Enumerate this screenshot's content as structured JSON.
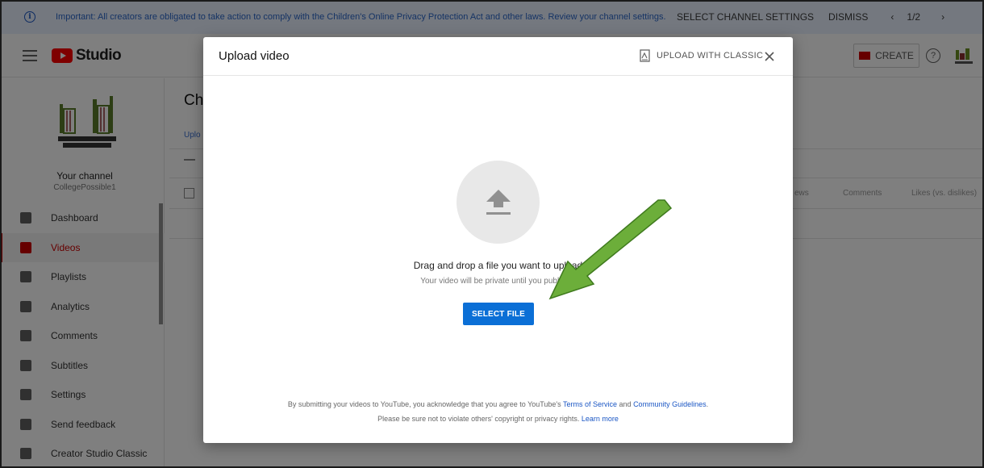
{
  "banner": {
    "message": "Important: All creators are obligated to take action to comply with the Children's Online Privacy Protection Act and other laws. Review your channel settings.",
    "select_settings": "SELECT CHANNEL SETTINGS",
    "dismiss": "DISMISS",
    "prev": "‹",
    "pager": "1/2",
    "next": "›"
  },
  "header": {
    "logo_text": "Studio",
    "create_label": "CREATE",
    "help_glyph": "?"
  },
  "sidebar": {
    "channel_name": "Your channel",
    "channel_handle": "CollegePossible1",
    "items": [
      {
        "label": "Dashboard",
        "icon": "dashboard-icon"
      },
      {
        "label": "Videos",
        "icon": "videos-icon",
        "active": true
      },
      {
        "label": "Playlists",
        "icon": "playlists-icon"
      },
      {
        "label": "Analytics",
        "icon": "analytics-icon"
      },
      {
        "label": "Comments",
        "icon": "comments-icon"
      },
      {
        "label": "Subtitles",
        "icon": "subtitles-icon"
      },
      {
        "label": "Settings",
        "icon": "settings-icon"
      },
      {
        "label": "Send feedback",
        "icon": "feedback-icon"
      },
      {
        "label": "Creator Studio Classic",
        "icon": "classic-icon"
      }
    ]
  },
  "content": {
    "title": "Cha",
    "tab": "Uplo",
    "columns": [
      "ews",
      "Comments",
      "Likes (vs. dislikes)"
    ]
  },
  "dialog": {
    "title": "Upload video",
    "classic_label": "UPLOAD WITH CLASSIC",
    "drag_text": "Drag and drop a file you want to upload",
    "private_text": "Your video will be private until you publish it",
    "select_label": "SELECT FILE",
    "terms_prefix": "By submitting your videos to YouTube, you acknowledge that you agree to YouTube's ",
    "terms_link": "Terms of Service",
    "terms_and": " and ",
    "guidelines_link": "Community Guidelines",
    "terms_suffix": ".",
    "copyright_text": "Please be sure not to violate others' copyright or privacy rights. ",
    "learn_more": "Learn more"
  },
  "colors": {
    "accent_red": "#cc0000",
    "button_blue": "#0b6fd6",
    "annotation_green": "#6cae3a"
  }
}
